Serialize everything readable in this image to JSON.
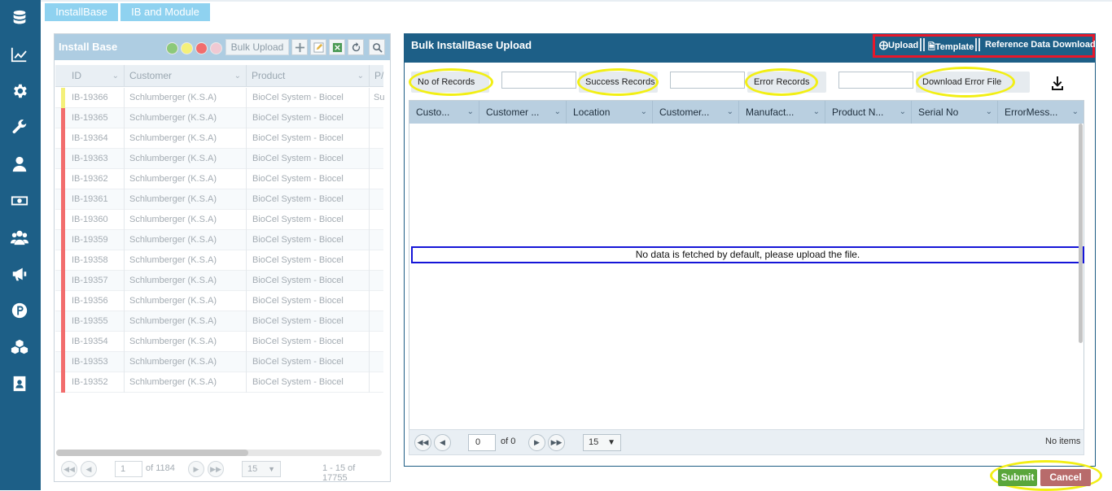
{
  "sidebar": {
    "items": [
      {
        "icon": "database-icon"
      },
      {
        "icon": "chart-line-icon"
      },
      {
        "icon": "gear-icon"
      },
      {
        "icon": "wrench-icon"
      },
      {
        "icon": "user-icon"
      },
      {
        "icon": "money-icon"
      },
      {
        "icon": "users-icon"
      },
      {
        "icon": "megaphone-icon"
      },
      {
        "icon": "parking-icon"
      },
      {
        "icon": "cubes-icon"
      },
      {
        "icon": "contact-book-icon"
      }
    ]
  },
  "tabs": [
    {
      "label": "InstallBase"
    },
    {
      "label": "IB and Module"
    }
  ],
  "install_base": {
    "title": "Install Base",
    "bulk_upload_label": "Bulk Upload",
    "dot_colors": [
      "#8cc97a",
      "#f4f07a",
      "#f26d6d",
      "#f0c9d3"
    ],
    "columns": [
      "ID",
      "Customer",
      "Product",
      "P/"
    ],
    "rows": [
      {
        "id": "IB-19366",
        "customer": "Schlumberger (K.S.A)",
        "product": "BioCel System - Biocel",
        "extra": "Su",
        "status_color": "#f4f07a"
      },
      {
        "id": "IB-19365",
        "customer": "Schlumberger (K.S.A)",
        "product": "BioCel System - Biocel",
        "extra": "",
        "status_color": "#f26d6d"
      },
      {
        "id": "IB-19364",
        "customer": "Schlumberger (K.S.A)",
        "product": "BioCel System - Biocel",
        "extra": "",
        "status_color": "#f26d6d"
      },
      {
        "id": "IB-19363",
        "customer": "Schlumberger (K.S.A)",
        "product": "BioCel System - Biocel",
        "extra": "",
        "status_color": "#f26d6d"
      },
      {
        "id": "IB-19362",
        "customer": "Schlumberger (K.S.A)",
        "product": "BioCel System - Biocel",
        "extra": "",
        "status_color": "#f26d6d"
      },
      {
        "id": "IB-19361",
        "customer": "Schlumberger (K.S.A)",
        "product": "BioCel System - Biocel",
        "extra": "",
        "status_color": "#f26d6d"
      },
      {
        "id": "IB-19360",
        "customer": "Schlumberger (K.S.A)",
        "product": "BioCel System - Biocel",
        "extra": "",
        "status_color": "#f26d6d"
      },
      {
        "id": "IB-19359",
        "customer": "Schlumberger (K.S.A)",
        "product": "BioCel System - Biocel",
        "extra": "",
        "status_color": "#f26d6d"
      },
      {
        "id": "IB-19358",
        "customer": "Schlumberger (K.S.A)",
        "product": "BioCel System - Biocel",
        "extra": "",
        "status_color": "#f26d6d"
      },
      {
        "id": "IB-19357",
        "customer": "Schlumberger (K.S.A)",
        "product": "BioCel System - Biocel",
        "extra": "",
        "status_color": "#f26d6d"
      },
      {
        "id": "IB-19356",
        "customer": "Schlumberger (K.S.A)",
        "product": "BioCel System - Biocel",
        "extra": "",
        "status_color": "#f26d6d"
      },
      {
        "id": "IB-19355",
        "customer": "Schlumberger (K.S.A)",
        "product": "BioCel System - Biocel",
        "extra": "",
        "status_color": "#f26d6d"
      },
      {
        "id": "IB-19354",
        "customer": "Schlumberger (K.S.A)",
        "product": "BioCel System - Biocel",
        "extra": "",
        "status_color": "#f26d6d"
      },
      {
        "id": "IB-19353",
        "customer": "Schlumberger (K.S.A)",
        "product": "BioCel System - Biocel",
        "extra": "",
        "status_color": "#f26d6d"
      },
      {
        "id": "IB-19352",
        "customer": "Schlumberger (K.S.A)",
        "product": "BioCel System - Biocel",
        "extra": "",
        "status_color": "#f26d6d"
      }
    ],
    "pager": {
      "page": "1",
      "of_pages": "of 1184",
      "page_size": "15",
      "summary": "1 - 15 of 17755"
    }
  },
  "bulk_upload": {
    "title": "Bulk InstallBase Upload",
    "upload_label": "Upload",
    "template_label": "Template",
    "reference_label": "Reference Data Download",
    "stats": {
      "no_of_records": "No of Records",
      "success_records": "Success Records",
      "error_records": "Error Records",
      "download_error_file": "Download Error File"
    },
    "columns": [
      "Custo...",
      "Customer ...",
      "Location",
      "Customer...",
      "Manufact...",
      "Product N...",
      "Serial No",
      "ErrorMess..."
    ],
    "no_data_message": "No data is fetched by default, please upload the file.",
    "pager": {
      "page": "0",
      "of_pages": "of 0",
      "page_size": "15",
      "summary": "No items"
    }
  },
  "actions": {
    "submit_label": "Submit",
    "cancel_label": "Cancel"
  },
  "colors": {
    "sidebar": "#1d5f87",
    "tab": "#8fd2f0",
    "highlight_red": "#e8172a",
    "highlight_yellow": "#f2ef14",
    "submit": "#5aa63b",
    "cancel": "#b86b6b"
  }
}
